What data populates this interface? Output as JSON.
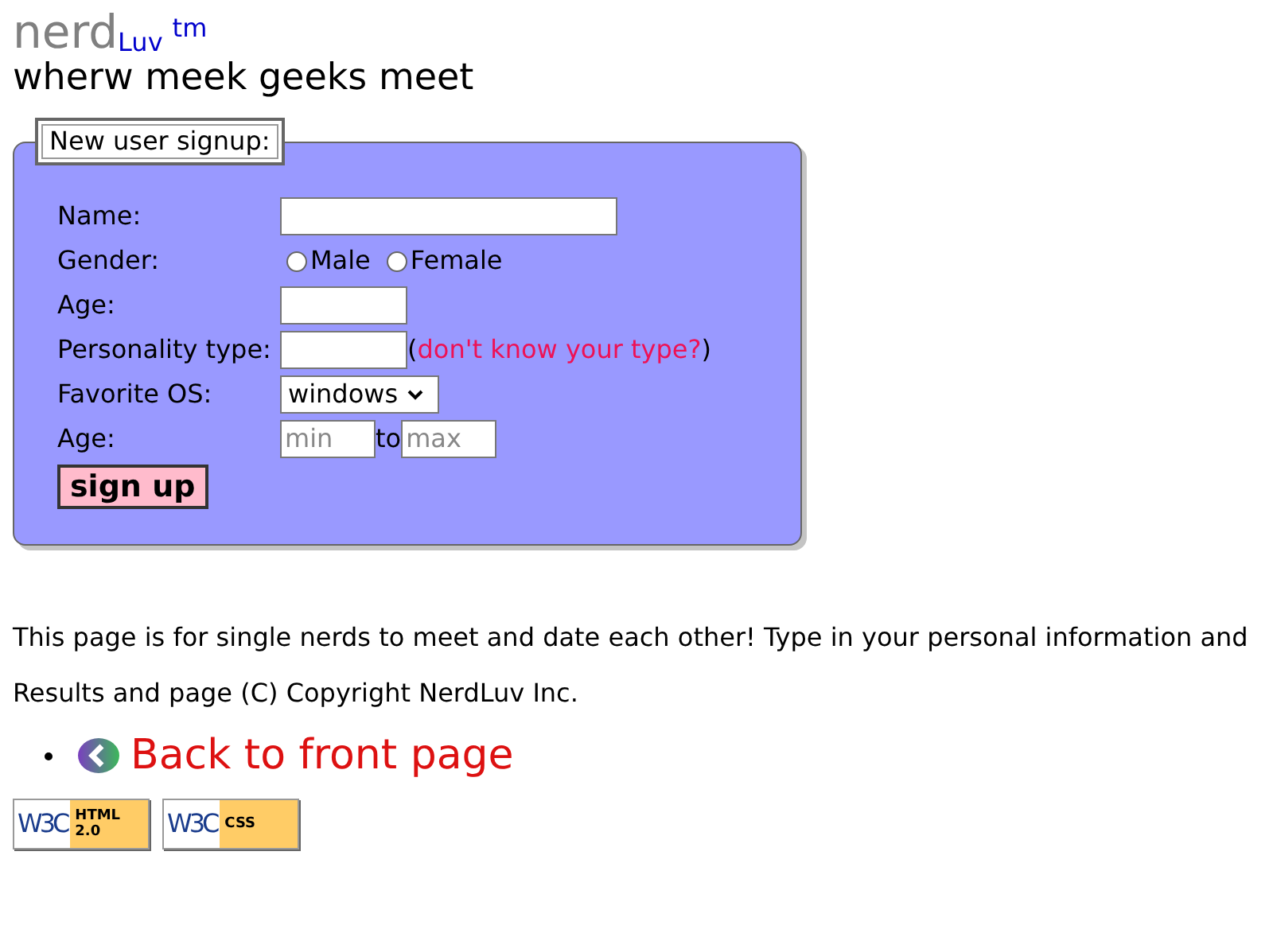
{
  "logo": {
    "word": "nerd",
    "sub": "Luv",
    "mark": "tm"
  },
  "tagline": "wherw meek geeks meet",
  "signup": {
    "legend": "New user signup:",
    "rows": [
      {
        "kind": "wide_text",
        "label": "Name:"
      },
      {
        "kind": "radio",
        "label": "Gender:",
        "options": [
          {
            "label": "Male",
            "selected": false
          },
          {
            "label": "Female",
            "selected": false
          }
        ]
      },
      {
        "kind": "short_text",
        "label": "Age:"
      },
      {
        "kind": "text_help",
        "label": "Personality type:",
        "open": "(",
        "link": "don't know your type?",
        "close": ")"
      },
      {
        "kind": "select",
        "label": "Favorite OS:",
        "value": "windows"
      },
      {
        "kind": "range",
        "label": "Age:",
        "min_placeholder": "min",
        "joiner": "to",
        "max_placeholder": "max"
      }
    ],
    "button": "sign up"
  },
  "intro": "This page is for single nerds to meet and date each other! Type in your personal information and",
  "copyright": "Results and page (C) Copyright NerdLuv Inc.",
  "links": [
    {
      "label": "Back to front page"
    }
  ],
  "badges": [
    {
      "logo": "W3C",
      "lines": [
        "HTML",
        "2.0"
      ]
    },
    {
      "logo": "W3C",
      "lines": [
        "CSS"
      ]
    }
  ]
}
